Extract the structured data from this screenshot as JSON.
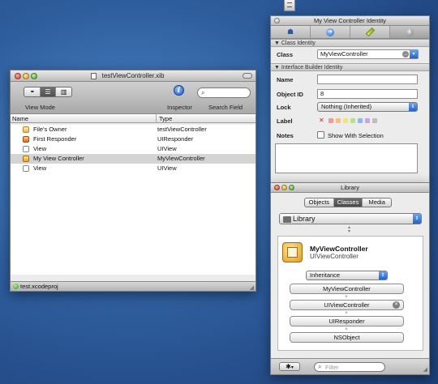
{
  "xib_window": {
    "title": "testViewController.xib",
    "toolbar": {
      "view_mode_label": "View Mode",
      "inspector_label": "Inspector",
      "search_field_label": "Search Field"
    },
    "columns": {
      "name": "Name",
      "type": "Type"
    },
    "rows": [
      {
        "name": "File's Owner",
        "type": "testViewController",
        "icon": "cube-icon",
        "selected": false
      },
      {
        "name": "First Responder",
        "type": "UIResponder",
        "icon": "responder-icon",
        "selected": false
      },
      {
        "name": "View",
        "type": "UIView",
        "icon": "view-icon",
        "selected": false
      },
      {
        "name": "My View Controller",
        "type": "MyViewController",
        "icon": "view-controller-icon",
        "selected": true
      },
      {
        "name": "View",
        "type": "UIView",
        "icon": "view-icon",
        "selected": false
      }
    ],
    "status_project": "test.xcodeproj"
  },
  "identity_inspector": {
    "title": "My View Controller Identity",
    "tab_icons": [
      "attributes-icon",
      "connections-icon",
      "size-icon",
      "identity-icon"
    ],
    "class_identity_header": "Class Identity",
    "class_label": "Class",
    "class_value": "MyViewController",
    "ib_identity_header": "Interface Builder Identity",
    "name_label": "Name",
    "name_value": "",
    "object_id_label": "Object ID",
    "object_id_value": "8",
    "lock_label": "Lock",
    "lock_value": "Nothing (Inherited)",
    "label_label": "Label",
    "label_clear_glyph": "✕",
    "label_colors": [
      "#f29a96",
      "#f6c07e",
      "#f3e47a",
      "#b5e38a",
      "#8fb6ee",
      "#c7a6e4",
      "#bdbdbd"
    ],
    "notes_label": "Notes",
    "show_with_selection": "Show With Selection"
  },
  "library": {
    "title": "Library",
    "segments": [
      "Objects",
      "Classes",
      "Media"
    ],
    "active_segment": "Classes",
    "popup_value": "Library",
    "class_name": "MyViewController",
    "superclass_name": "UIViewController",
    "inheritance_popup": "Inheritance",
    "chain": [
      "MyViewController",
      "UIViewController",
      "UIResponder",
      "NSObject"
    ],
    "filter_placeholder": "Filter",
    "gear_glyph": "✱",
    "gear_caret": "▾"
  },
  "menu_extra_icon": "clipboard-icon"
}
